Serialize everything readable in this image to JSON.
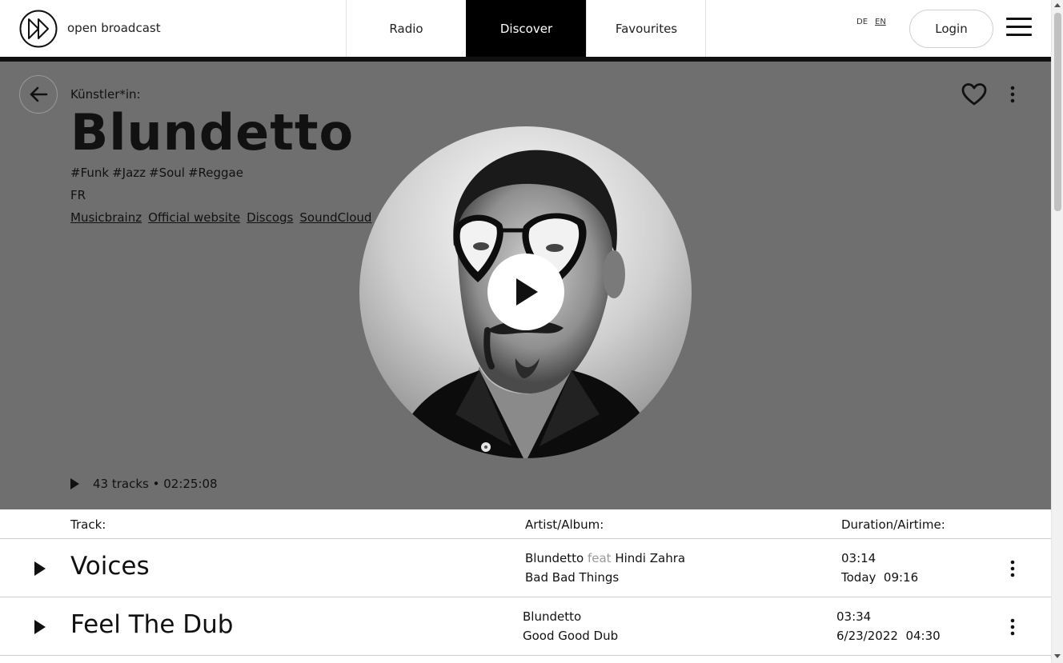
{
  "header": {
    "brand": "open broadcast",
    "nav": [
      {
        "label": "Radio",
        "active": false
      },
      {
        "label": "Discover",
        "active": true
      },
      {
        "label": "Favourites",
        "active": false
      }
    ],
    "languages": [
      {
        "label": "DE",
        "active": false
      },
      {
        "label": "EN",
        "active": true
      }
    ],
    "login_label": "Login"
  },
  "artist": {
    "kicker": "Künstler*in:",
    "name": "Blundetto",
    "tags": [
      "#Funk",
      "#Jazz",
      "#Soul",
      "#Reggae"
    ],
    "country": "FR",
    "links": [
      "Musicbrainz",
      "Official website",
      "Discogs",
      "SoundCloud"
    ],
    "track_summary": "43 tracks • 02:25:08"
  },
  "table": {
    "headers": {
      "track": "Track:",
      "artist_album": "Artist/Album:",
      "duration_airtime": "Duration/Airtime:"
    },
    "rows": [
      {
        "title": "Voices",
        "artist": "Blundetto",
        "feat_label": "feat",
        "feat_artist": "Hindi Zahra",
        "album": "Bad Bad Things",
        "duration": "03:14",
        "airtime": "Today  09:16"
      },
      {
        "title": "Feel The Dub",
        "artist": "Blundetto",
        "feat_label": "",
        "feat_artist": "",
        "album": "Good Good Dub",
        "duration": "03:34",
        "airtime": "6/23/2022  04:30"
      }
    ]
  },
  "colors": {
    "hero_background": "#6f6f6f",
    "active_tab": "#000000",
    "feat_text": "#999999"
  },
  "icons": [
    "logo-icon",
    "arrow-left-icon",
    "heart-icon",
    "more-vertical-icon",
    "play-icon",
    "menu-icon"
  ]
}
